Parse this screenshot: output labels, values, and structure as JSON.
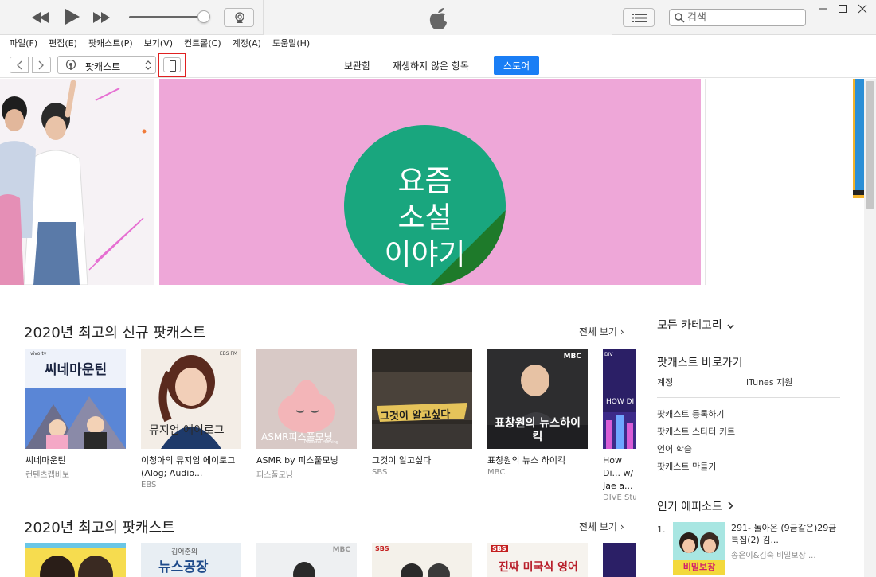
{
  "titlebar": {
    "search_placeholder": "검색"
  },
  "menu": [
    "파일(F)",
    "편집(E)",
    "팟캐스트(P)",
    "보기(V)",
    "컨트롤(C)",
    "계정(A)",
    "도움말(H)"
  ],
  "nav": {
    "media_label": "팟캐스트",
    "tabs": [
      "보관함",
      "재생하지 않은 항목",
      "스토어"
    ],
    "active_tab": "스토어"
  },
  "hero": {
    "main_text": [
      "요즘",
      "소설",
      "이야기"
    ]
  },
  "colors": {
    "accent": "#1a7ef5",
    "hero_pink": "#eea7d8",
    "hero_circle": "#19a67e",
    "highlight_red": "#e02020"
  },
  "sections": [
    {
      "title": "2020년 최고의 신규 팟캐스트",
      "see_all": "전체 보기",
      "items": [
        {
          "title": "씨네마운틴",
          "sub": "컨텐츠랩비보",
          "cover_text": "씨네마운틴",
          "cover_label": "vivo tv"
        },
        {
          "title": "이청아의 뮤지엄 에이로그 (Alog; Audio...",
          "sub": "EBS",
          "cover_text": "뮤지엄 에이로그",
          "cover_label": "EBS FM"
        },
        {
          "title": "ASMR by 피스풀모닝",
          "sub": "피스풀모닝",
          "cover_text": "ASMR피스풀모닝",
          "cover_label": "Peaceful Morning"
        },
        {
          "title": "그것이 알고싶다",
          "sub": "SBS",
          "cover_text": "그것이 알고싶다",
          "cover_label": ""
        },
        {
          "title": "표창원의 뉴스 하이킥",
          "sub": "MBC",
          "cover_text": "표창원의 뉴스하이킥",
          "cover_label": "MBC"
        },
        {
          "title": "How Di... w/ Jae a...",
          "sub": "DIVE Stu...",
          "cover_text": "HOW DI",
          "cover_label": "DIV"
        }
      ]
    },
    {
      "title": "2020년 최고의 팟캐스트",
      "see_all": "전체 보기",
      "items": [
        {
          "cover_text": "",
          "cover_label": ""
        },
        {
          "cover_text": "뉴스공장",
          "cover_label": "김어준의"
        },
        {
          "cover_text": "",
          "cover_label": "MBC"
        },
        {
          "cover_text": "",
          "cover_label": "SBS"
        },
        {
          "cover_text": "진짜 미국식 영어",
          "cover_label": "SBS"
        },
        {
          "cover_text": "",
          "cover_label": ""
        }
      ]
    }
  ],
  "sidebar": {
    "all_categories": "모든 카테고리",
    "shortcuts_title": "팟캐스트 바로가기",
    "account": "계정",
    "itunes_support": "iTunes 지원",
    "links": [
      "팟캐스트 등록하기",
      "팟캐스트 스타터 키트",
      "언어 학습",
      "팟캐스트 만들기"
    ],
    "popular_episodes": "인기 에피소드",
    "episode": {
      "rank": "1.",
      "title": "291- 돌아온 (9금같은)29금 특집(2) 김...",
      "author": "송은이&김숙 비밀보장 ...",
      "cover_text": "비밀보장"
    }
  }
}
